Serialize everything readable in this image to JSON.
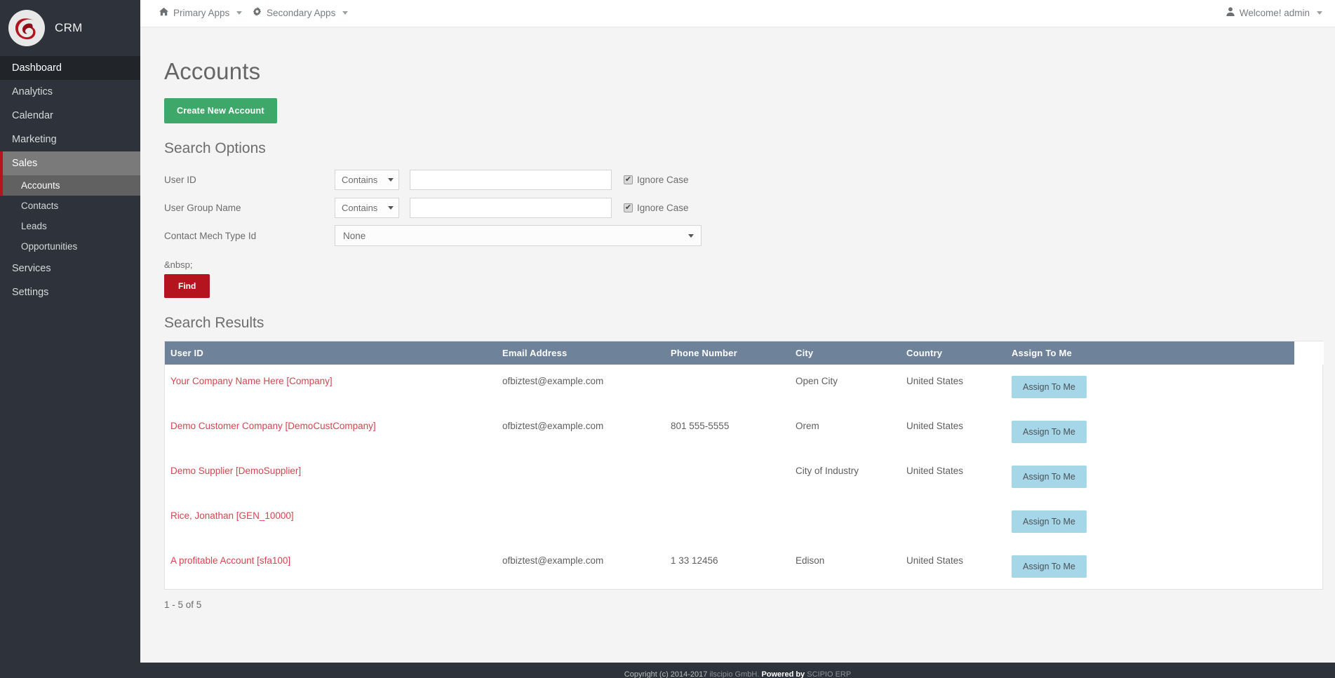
{
  "brand": {
    "title": "CRM",
    "logo_icon": "scipio-swirl-logo-icon"
  },
  "sidebar": {
    "items": [
      {
        "label": "Dashboard",
        "state": "active-dark",
        "level": "top"
      },
      {
        "label": "Analytics",
        "state": "",
        "level": "top"
      },
      {
        "label": "Calendar",
        "state": "",
        "level": "top"
      },
      {
        "label": "Marketing",
        "state": "",
        "level": "top"
      },
      {
        "label": "Sales",
        "state": "active-gray",
        "level": "top"
      },
      {
        "label": "Accounts",
        "state": "active-sub",
        "level": "sub"
      },
      {
        "label": "Contacts",
        "state": "",
        "level": "sub"
      },
      {
        "label": "Leads",
        "state": "",
        "level": "sub"
      },
      {
        "label": "Opportunities",
        "state": "",
        "level": "sub"
      },
      {
        "label": "Services",
        "state": "",
        "level": "top"
      },
      {
        "label": "Settings",
        "state": "",
        "level": "top"
      }
    ]
  },
  "topbar": {
    "primary_apps": "Primary Apps",
    "primary_apps_icon": "home-icon",
    "secondary_apps": "Secondary Apps",
    "secondary_apps_icon": "gear-icon",
    "user_greeting": "Welcome! admin",
    "user_icon": "user-icon",
    "caret_icon": "chevron-down-icon"
  },
  "page": {
    "title": "Accounts",
    "create_button": "Create New Account"
  },
  "search_options": {
    "heading": "Search Options",
    "nbsp_literal": "&nbsp;",
    "find_button": "Find",
    "rows": [
      {
        "label": "User ID",
        "operator": "Contains",
        "value": "",
        "placeholder": "",
        "ignore_case_label": "Ignore Case",
        "ignore_case_checked": true,
        "check_glyph": "✔"
      },
      {
        "label": "User Group Name",
        "operator": "Contains",
        "value": "",
        "placeholder": "",
        "ignore_case_label": "Ignore Case",
        "ignore_case_checked": true,
        "check_glyph": "✔"
      }
    ],
    "contact_mech": {
      "label": "Contact Mech Type Id",
      "selected": "None"
    }
  },
  "search_results": {
    "heading": "Search Results",
    "columns": [
      "User ID",
      "Email Address",
      "Phone Number",
      "City",
      "Country",
      "Assign To Me"
    ],
    "rows": [
      {
        "user_id": "Your Company Name Here [Company]",
        "email": "ofbiztest@example.com",
        "phone": "",
        "city": "Open City",
        "country": "United States",
        "assign_label": "Assign To Me"
      },
      {
        "user_id": "Demo Customer Company [DemoCustCompany]",
        "email": "ofbiztest@example.com",
        "phone": "801 555-5555",
        "city": "Orem",
        "country": "United States",
        "assign_label": "Assign To Me"
      },
      {
        "user_id": "Demo Supplier [DemoSupplier]",
        "email": "",
        "phone": "",
        "city": "City of Industry",
        "country": "United States",
        "assign_label": "Assign To Me"
      },
      {
        "user_id": "Rice, Jonathan [GEN_10000]",
        "email": "",
        "phone": "",
        "city": "",
        "country": "",
        "assign_label": "Assign To Me"
      },
      {
        "user_id": "A profitable Account [sfa100]",
        "email": "ofbiztest@example.com",
        "phone": "1 33 12456",
        "city": "Edison",
        "country": "United States",
        "assign_label": "Assign To Me"
      }
    ],
    "pager": "1 - 5 of 5"
  },
  "footer": {
    "copyright": "Copyright (c) 2014-2017",
    "company": "ilscipio GmbH.",
    "powered_by": "Powered by",
    "product": "SCIPIO ERP"
  },
  "colors": {
    "sidebar_bg": "#2e323a",
    "accent_red": "#b4141e",
    "link_red": "#d9424e",
    "create_green": "#3ea86a",
    "table_header": "#6e8299",
    "assign_blue": "#a5d7e8"
  }
}
